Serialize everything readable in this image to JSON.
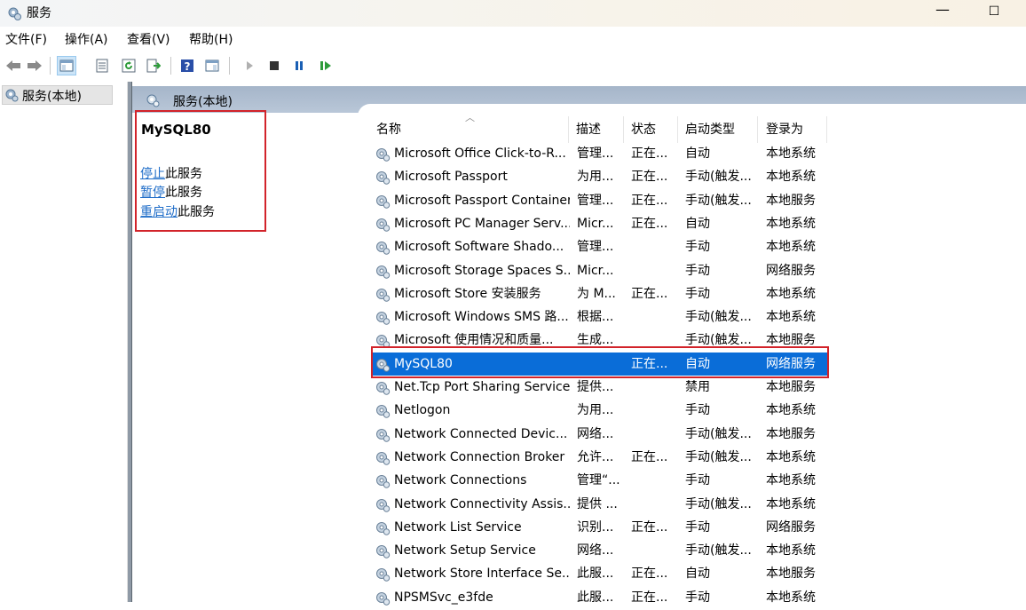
{
  "window": {
    "title": "服务",
    "minimize_glyph": "—",
    "maximize_glyph": "☐"
  },
  "menu": {
    "items": [
      "文件(F)",
      "操作(A)",
      "查看(V)",
      "帮助(H)"
    ]
  },
  "toolbar": {
    "icons": [
      "back-arrow-icon",
      "forward-arrow-icon",
      "show-hide-console-tree-icon",
      "properties-icon",
      "refresh-icon",
      "export-list-icon",
      "help-icon",
      "show-action-pane-icon",
      "start-service-icon",
      "stop-service-icon",
      "pause-service-icon",
      "restart-service-icon"
    ]
  },
  "tree": {
    "node_label": "服务(本地)"
  },
  "pane": {
    "header_label": "服务(本地)"
  },
  "extended": {
    "service_name": "MySQL80",
    "actions": [
      {
        "link": "停止",
        "suffix": "此服务"
      },
      {
        "link": "暂停",
        "suffix": "此服务"
      },
      {
        "link": "重启动",
        "suffix": "此服务"
      }
    ]
  },
  "table": {
    "columns": [
      "名称",
      "描述",
      "状态",
      "启动类型",
      "登录为"
    ],
    "selected_index": 9,
    "rows": [
      [
        "Microsoft Office Click-to-R...",
        "管理...",
        "正在...",
        "自动",
        "本地系统"
      ],
      [
        "Microsoft Passport",
        "为用...",
        "正在...",
        "手动(触发...",
        "本地系统"
      ],
      [
        "Microsoft Passport Container",
        "管理...",
        "正在...",
        "手动(触发...",
        "本地服务"
      ],
      [
        "Microsoft PC Manager Serv...",
        "Micr...",
        "正在...",
        "自动",
        "本地系统"
      ],
      [
        "Microsoft Software Shado...",
        "管理...",
        "",
        "手动",
        "本地系统"
      ],
      [
        "Microsoft Storage Spaces S...",
        "Micr...",
        "",
        "手动",
        "网络服务"
      ],
      [
        "Microsoft Store 安装服务",
        "为 M...",
        "正在...",
        "手动",
        "本地系统"
      ],
      [
        "Microsoft Windows SMS 路...",
        "根据...",
        "",
        "手动(触发...",
        "本地系统"
      ],
      [
        "Microsoft 使用情况和质量...",
        "生成...",
        "",
        "手动(触发...",
        "本地服务"
      ],
      [
        "MySQL80",
        "",
        "正在...",
        "自动",
        "网络服务"
      ],
      [
        "Net.Tcp Port Sharing Service",
        "提供...",
        "",
        "禁用",
        "本地服务"
      ],
      [
        "Netlogon",
        "为用...",
        "",
        "手动",
        "本地系统"
      ],
      [
        "Network Connected Devic...",
        "网络...",
        "",
        "手动(触发...",
        "本地服务"
      ],
      [
        "Network Connection Broker",
        "允许...",
        "正在...",
        "手动(触发...",
        "本地系统"
      ],
      [
        "Network Connections",
        "管理“...",
        "",
        "手动",
        "本地系统"
      ],
      [
        "Network Connectivity Assis...",
        "提供 ...",
        "",
        "手动(触发...",
        "本地系统"
      ],
      [
        "Network List Service",
        "识别...",
        "正在...",
        "手动",
        "网络服务"
      ],
      [
        "Network Setup Service",
        "网络...",
        "",
        "手动(触发...",
        "本地系统"
      ],
      [
        "Network Store Interface Se...",
        "此服...",
        "正在...",
        "自动",
        "本地服务"
      ],
      [
        "NPSMSvc_e3fde",
        "此服...",
        "正在...",
        "手动",
        "本地系统"
      ]
    ]
  },
  "colors": {
    "selection": "#0a6dd8",
    "highlight_box": "#d2232a",
    "link": "#1e6cc8",
    "pane_header": "#b0bfd1"
  }
}
